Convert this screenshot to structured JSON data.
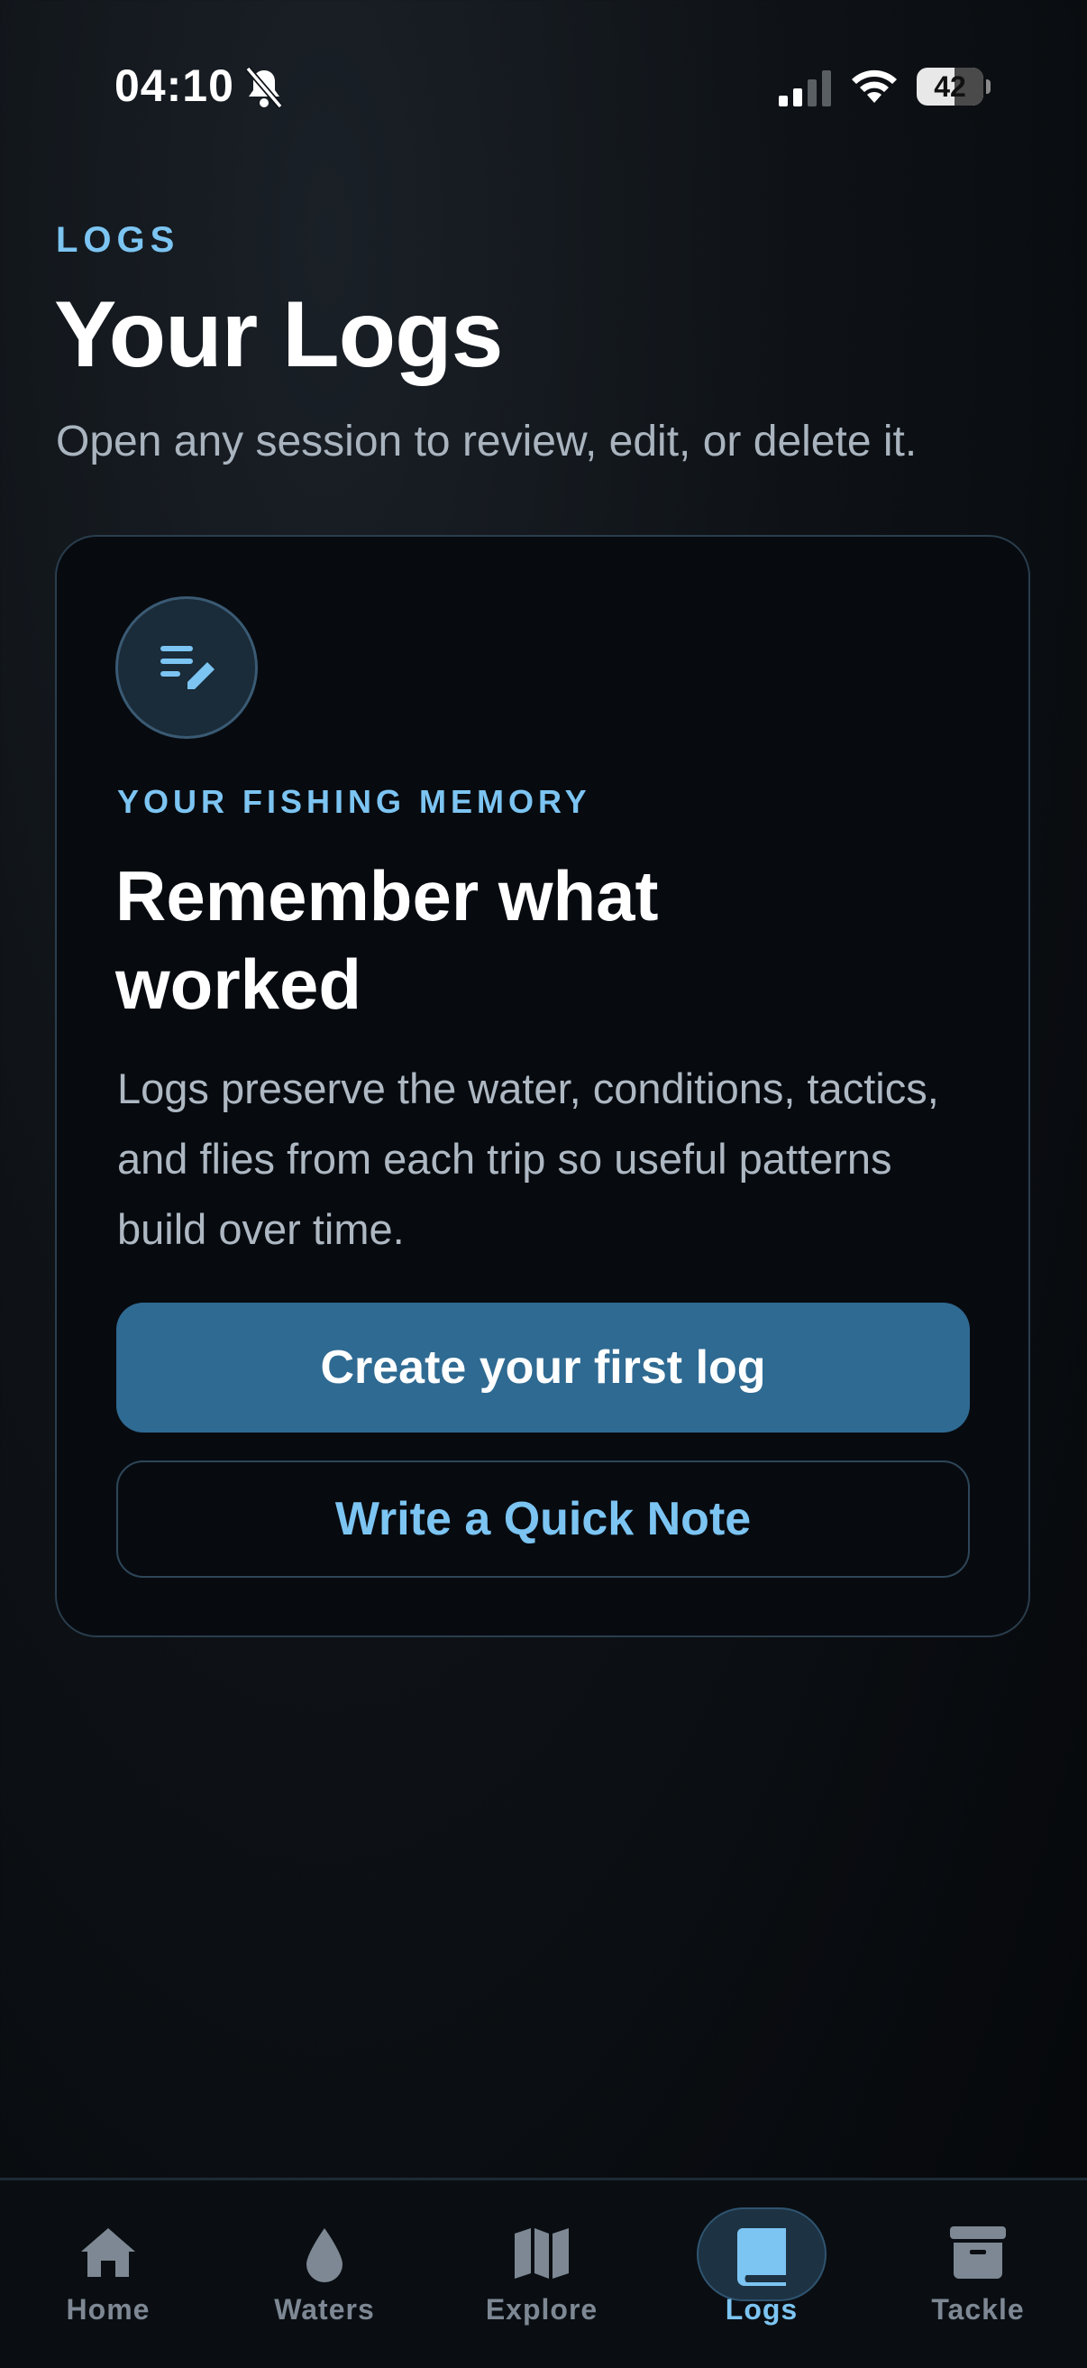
{
  "status_bar": {
    "time": "04:10",
    "battery": "42"
  },
  "header": {
    "eyebrow": "LOGS",
    "title": "Your Logs",
    "subtitle": "Open any session to review, edit, or delete it."
  },
  "empty_card": {
    "eyebrow": "YOUR FISHING MEMORY",
    "title": "Remember what worked",
    "body": "Logs preserve the water, conditions, tactics, and flies from each trip so useful patterns build over time.",
    "primary_button": "Create your first log",
    "secondary_button": "Write a Quick Note"
  },
  "tabs": [
    {
      "label": "Home",
      "icon": "home-icon"
    },
    {
      "label": "Waters",
      "icon": "water-drop-icon"
    },
    {
      "label": "Explore",
      "icon": "map-icon"
    },
    {
      "label": "Logs",
      "icon": "book-icon",
      "active": true
    },
    {
      "label": "Tackle",
      "icon": "tackle-box-icon"
    }
  ],
  "colors": {
    "accent": "#7cc4f2",
    "primary_button": "#2f6a92",
    "background": "#0b0f13"
  }
}
